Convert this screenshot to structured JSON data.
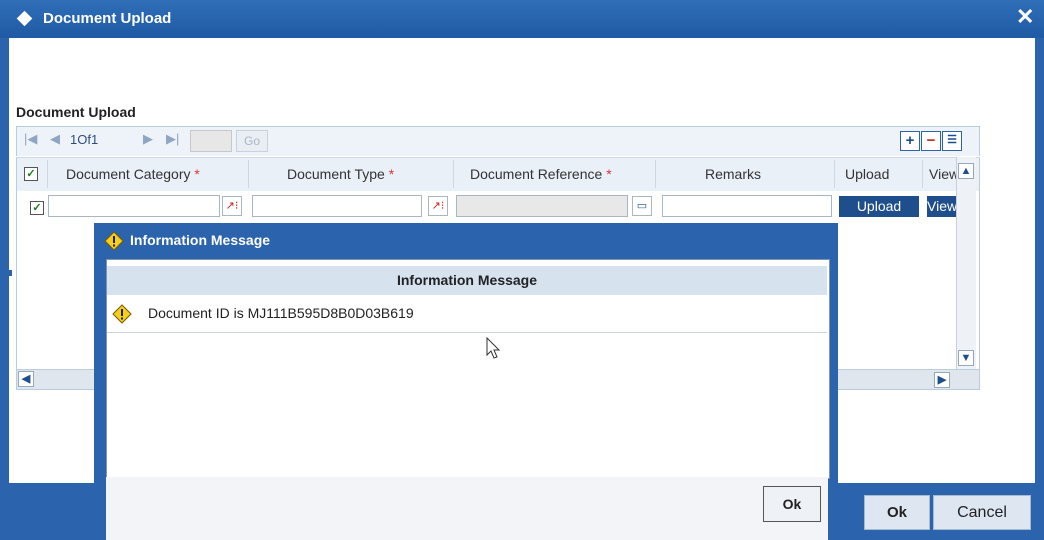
{
  "window": {
    "title": "Document Upload",
    "close_label": "✕"
  },
  "section": {
    "title": "Document Upload"
  },
  "pager": {
    "page_info": "1Of1",
    "go_label": "Go",
    "page_value": ""
  },
  "grid": {
    "columns": [
      {
        "label": "Document Category",
        "required": "*"
      },
      {
        "label": "Document Type",
        "required": "*"
      },
      {
        "label": "Document Reference",
        "required": "*"
      },
      {
        "label": "Remarks"
      },
      {
        "label": "Upload"
      },
      {
        "label": "View"
      }
    ],
    "row": {
      "upload_label": "Upload",
      "view_label": "View"
    }
  },
  "footer": {
    "ok_label": "Ok",
    "cancel_label": "Cancel"
  },
  "modal": {
    "title": "Information Message",
    "header": "Information Message",
    "message": "Document ID is MJ111B595D8B0D03B619",
    "ok_label": "Ok"
  }
}
